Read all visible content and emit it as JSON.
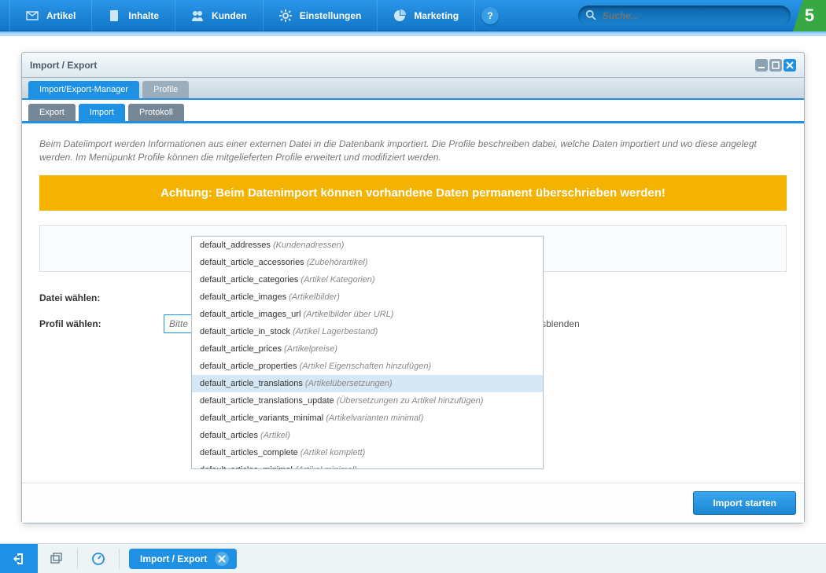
{
  "nav": {
    "items": [
      {
        "label": "Artikel",
        "icon": "envelope"
      },
      {
        "label": "Inhalte",
        "icon": "doc"
      },
      {
        "label": "Kunden",
        "icon": "people"
      },
      {
        "label": "Einstellungen",
        "icon": "gear"
      },
      {
        "label": "Marketing",
        "icon": "piechart"
      }
    ],
    "search_placeholder": "Suche...",
    "logo": "5"
  },
  "window": {
    "title": "Import / Export",
    "tabs_main": [
      {
        "label": "Import/Export-Manager",
        "active": true
      },
      {
        "label": "Profile",
        "active": false
      }
    ],
    "tabs_inner": [
      {
        "label": "Export",
        "active": false
      },
      {
        "label": "Import",
        "active": true
      },
      {
        "label": "Protokoll",
        "active": false
      }
    ],
    "intro": "Beim Dateiimport werden Informationen aus einer externen Datei in die Datenbank importiert. Die Profile beschreiben dabei, welche Daten importiert und wo diese angelegt werden. Im Menüpunkt Profile können die mitgelieferten Profile erweitert und modifiziert werden.",
    "warning": "Achtung: Beim Datenimport können vorhandene Daten permanent überschrieben werden!",
    "dropzone_text": "",
    "file_label": "Datei wählen:",
    "profile_label": "Profil wählen:",
    "profile_placeholder": "Bitte wählen",
    "hide_defaults": "Standardprofile ausblenden",
    "start_button": "Import starten"
  },
  "dropdown": {
    "options": [
      {
        "key": "default_addresses",
        "desc": "Kundenadressen"
      },
      {
        "key": "default_article_accessories",
        "desc": "Zubehörartikel"
      },
      {
        "key": "default_article_categories",
        "desc": "Artikel Kategorien"
      },
      {
        "key": "default_article_images",
        "desc": "Artikelbilder"
      },
      {
        "key": "default_article_images_url",
        "desc": "Artikelbilder über URL"
      },
      {
        "key": "default_article_in_stock",
        "desc": "Artikel Lagerbestand"
      },
      {
        "key": "default_article_prices",
        "desc": "Artikelpreise"
      },
      {
        "key": "default_article_properties",
        "desc": "Artikel Eigenschaften hinzufügen"
      },
      {
        "key": "default_article_translations",
        "desc": "Artikelübersetzungen",
        "selected": true
      },
      {
        "key": "default_article_translations_update",
        "desc": "Übersetzungen zu Artikel hinzufügen"
      },
      {
        "key": "default_article_variants_minimal",
        "desc": "Artikelvarianten minimal"
      },
      {
        "key": "default_articles",
        "desc": "Artikel"
      },
      {
        "key": "default_articles_complete",
        "desc": "Artikel komplett"
      },
      {
        "key": "default_articles_minimal",
        "desc": "Artikel minimal"
      }
    ]
  },
  "taskbar": {
    "task_label": "Import / Export"
  }
}
